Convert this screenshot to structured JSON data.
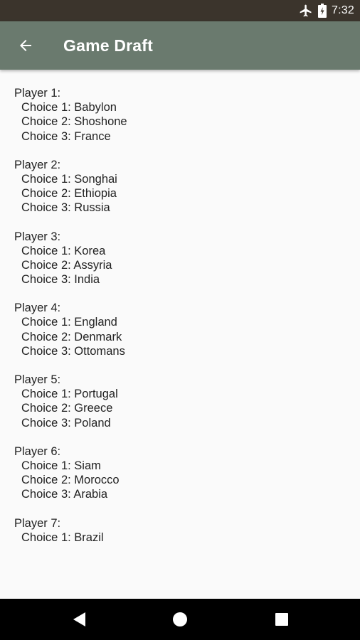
{
  "status_bar": {
    "time": "7:32",
    "icons": [
      "airplane-icon",
      "battery-icon"
    ]
  },
  "app_bar": {
    "title": "Game Draft",
    "back_icon": "arrow-back-icon"
  },
  "players": [
    {
      "label": "Player 1:",
      "choices": [
        "Choice 1: Babylon",
        "Choice 2: Shoshone",
        "Choice 3: France"
      ]
    },
    {
      "label": "Player 2:",
      "choices": [
        "Choice 1: Songhai",
        "Choice 2: Ethiopia",
        "Choice 3: Russia"
      ]
    },
    {
      "label": "Player 3:",
      "choices": [
        "Choice 1: Korea",
        "Choice 2: Assyria",
        "Choice 3: India"
      ]
    },
    {
      "label": "Player 4:",
      "choices": [
        "Choice 1: England",
        "Choice 2: Denmark",
        "Choice 3: Ottomans"
      ]
    },
    {
      "label": "Player 5:",
      "choices": [
        "Choice 1: Portugal",
        "Choice 2: Greece",
        "Choice 3: Poland"
      ]
    },
    {
      "label": "Player 6:",
      "choices": [
        "Choice 1: Siam",
        "Choice 2: Morocco",
        "Choice 3: Arabia"
      ]
    },
    {
      "label": "Player 7:",
      "choices": [
        "Choice 1: Brazil"
      ]
    }
  ],
  "nav_bar": {
    "icons": [
      "back-triangle-icon",
      "home-circle-icon",
      "recents-square-icon"
    ]
  },
  "colors": {
    "status_bar": "#3b342c",
    "app_bar": "#6a7a6e",
    "background": "#fafafa",
    "text": "#222222",
    "nav_bar": "#000000"
  }
}
